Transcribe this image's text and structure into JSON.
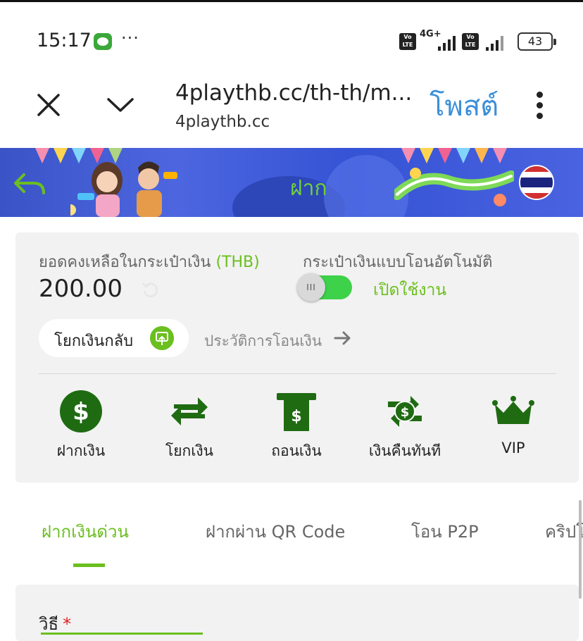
{
  "status_bar": {
    "time": "15:17",
    "overflow": "···",
    "volte_label": "Vo LTE",
    "network": "4G+",
    "battery": "43"
  },
  "browser": {
    "url": "4playthb.cc/th-th/m...",
    "domain": "4playthb.cc",
    "post_button": "โพสต์"
  },
  "banner": {
    "title": "ฝาก"
  },
  "wallet": {
    "balance_label": "ยอดคงเหลือในกระเป๋าเงิน",
    "currency": "(THB)",
    "balance": "200.00",
    "auto_label": "กระเป๋าเงินแบบโอนอัตโนมัติ",
    "toggle_state": "on",
    "toggle_knob": "III",
    "enable_label": "เปิดใช้งาน",
    "transfer_back": "โยกเงินกลับ",
    "history": "ประวัติการโอนเงิน"
  },
  "actions": [
    {
      "label": "ฝากเงิน",
      "icon": "dollar-circle-icon"
    },
    {
      "label": "โยกเงิน",
      "icon": "swap-arrows-icon"
    },
    {
      "label": "ถอนเงิน",
      "icon": "atm-withdraw-icon"
    },
    {
      "label": "เงินคืนทันที",
      "icon": "cashback-icon"
    },
    {
      "label": "VIP",
      "icon": "crown-icon"
    }
  ],
  "tabs": [
    {
      "label": "ฝากเงินด่วน",
      "active": true
    },
    {
      "label": "ฝากผ่าน QR Code",
      "active": false
    },
    {
      "label": "โอน P2P",
      "active": false
    },
    {
      "label": "คริปโ",
      "active": false
    }
  ],
  "method": {
    "label": "วิธี",
    "required_mark": "*"
  },
  "colors": {
    "accent_green": "#6bbf1f",
    "icon_green": "#1f6b12",
    "post_blue": "#3b8fd9",
    "toggle_green": "#3ed14a"
  }
}
